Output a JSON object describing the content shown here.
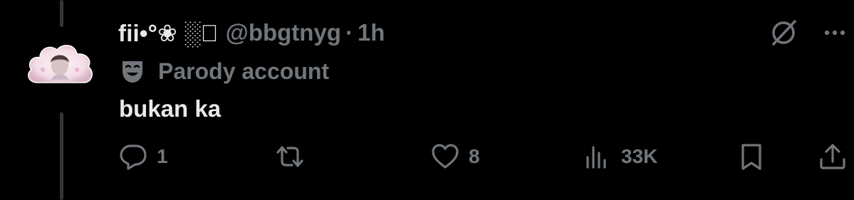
{
  "tweet": {
    "display_name": "fii•°❀ ░⃝ ",
    "handle": "@bbgtnyg",
    "separator": "·",
    "time": "1h",
    "label": "Parody account",
    "text": "bukan ka"
  },
  "icons": {
    "avatar": "cloud-avatar",
    "grok": "grok-icon",
    "more": "more-icon",
    "parody": "theater-mask-icon",
    "reply": "reply-icon",
    "retweet": "retweet-icon",
    "like": "heart-icon",
    "views": "views-icon",
    "bookmark": "bookmark-icon",
    "share": "share-icon"
  },
  "actions": {
    "reply_count": "1",
    "retweet_count": "",
    "like_count": "8",
    "views_count": "33K"
  },
  "colors": {
    "background": "#000000",
    "primary_text": "#e7e9ea",
    "secondary_text": "#71767b",
    "thread_line": "#333639"
  }
}
